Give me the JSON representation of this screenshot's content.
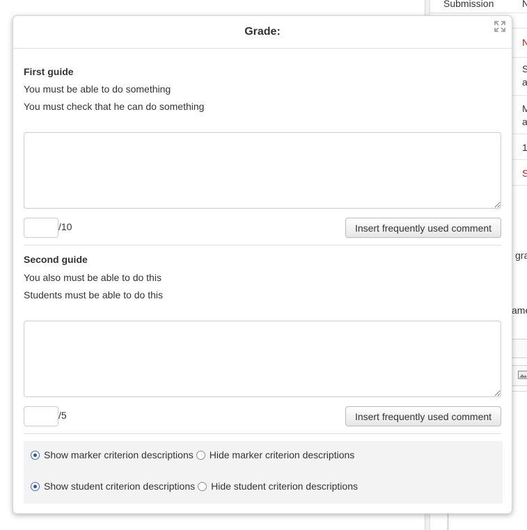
{
  "background": {
    "cells": [
      "Submission",
      "N",
      "N",
      "S",
      "a",
      "M",
      "a",
      "1",
      "S",
      "gra",
      "ame"
    ]
  },
  "dialog": {
    "title": "Grade:",
    "guides": [
      {
        "title": "First guide",
        "descriptions": [
          "You must be able to do something",
          "You must check that he can do something"
        ],
        "comment": "",
        "score": "",
        "max_score": "/10",
        "insert_label": "Insert frequently used comment"
      },
      {
        "title": "Second guide",
        "descriptions": [
          "You also must be able to do this",
          "Students must be able to do this"
        ],
        "comment": "",
        "score": "",
        "max_score": "/5",
        "insert_label": "Insert frequently used comment"
      }
    ],
    "options": {
      "marker_show": "Show marker criterion descriptions",
      "marker_hide": "Hide marker criterion descriptions",
      "marker_selected": "show",
      "student_show": "Show student criterion descriptions",
      "student_hide": "Hide student criterion descriptions",
      "student_selected": "show"
    }
  }
}
